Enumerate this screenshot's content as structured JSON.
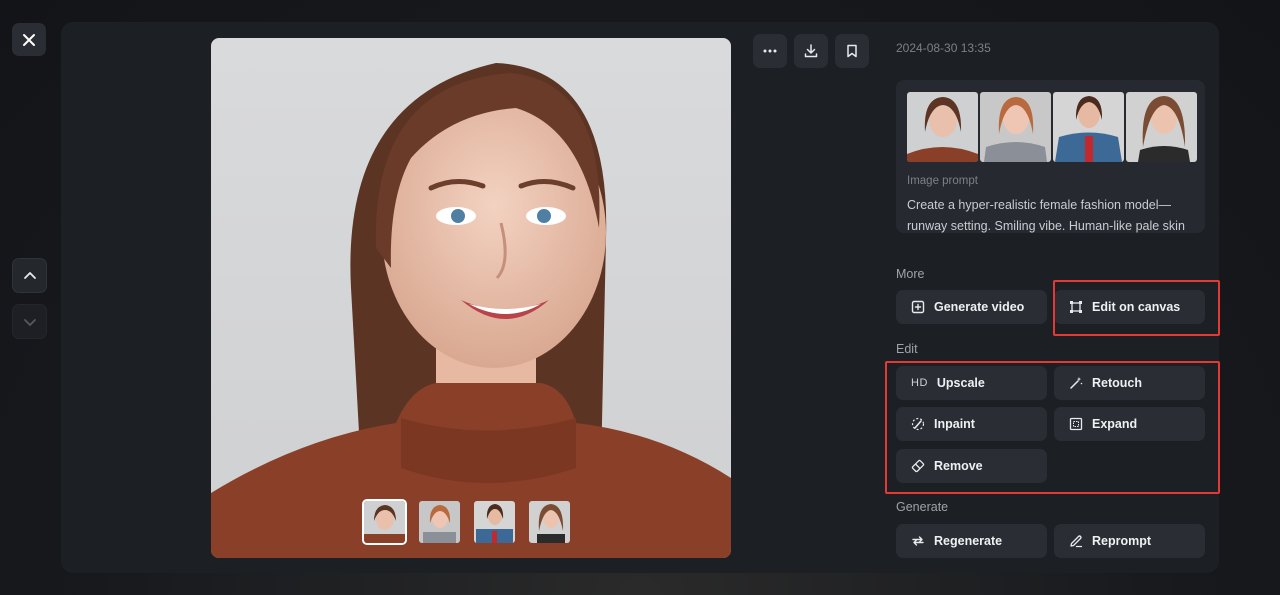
{
  "header": {
    "close_icon": "close-icon",
    "timestamp": "2024-08-30 13:35"
  },
  "navigation": {
    "up_icon": "chevron-up-icon",
    "down_icon": "chevron-down-icon"
  },
  "toolbar": {
    "more_icon": "more-horizontal-icon",
    "download_icon": "download-icon",
    "bookmark_icon": "bookmark-icon"
  },
  "prompt": {
    "label": "Image prompt",
    "text": "Create a hyper-realistic female fashion model—runway setting. Smiling vibe. Human-like pale skin ton"
  },
  "sections": {
    "more": {
      "label": "More",
      "generate_video": "Generate video",
      "edit_on_canvas": "Edit on canvas"
    },
    "edit": {
      "label": "Edit",
      "upscale_prefix": "HD",
      "upscale": "Upscale",
      "retouch": "Retouch",
      "inpaint": "Inpaint",
      "expand": "Expand",
      "remove": "Remove"
    },
    "generate": {
      "label": "Generate",
      "regenerate": "Regenerate",
      "reprompt": "Reprompt"
    }
  },
  "colors": {
    "highlight": "#e53935",
    "panel": "#1c1f24",
    "button": "#2a2d33"
  }
}
